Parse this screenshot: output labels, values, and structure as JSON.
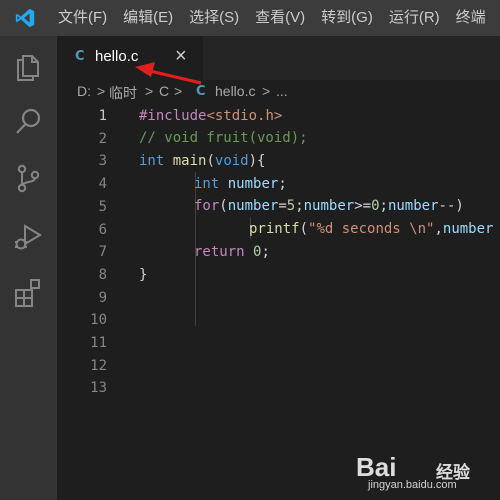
{
  "menu": [
    "文件(F)",
    "编辑(E)",
    "选择(S)",
    "查看(V)",
    "转到(G)",
    "运行(R)",
    "终端"
  ],
  "tab": {
    "title": "hello.c",
    "close": "×",
    "icon_letter": "C"
  },
  "breadcrumb": {
    "drive": "D:",
    "folder1": "临时",
    "folder2": "C",
    "file": "hello.c",
    "more": "...",
    "sep": ">"
  },
  "line_numbers": [
    "1",
    "2",
    "3",
    "4",
    "5",
    "6",
    "7",
    "8",
    "9",
    "10",
    "11",
    "12",
    "13"
  ],
  "code": {
    "l1": {
      "directive": "#include",
      "header": "<stdio.h>"
    },
    "l2": {
      "comment": "// void fruit(void);"
    },
    "l3": {
      "type": "int",
      "name": "main",
      "open": "(",
      "param": "void",
      "close": "){"
    },
    "l4": {
      "type": "int",
      "var": "number",
      "end": ";"
    },
    "l5": {
      "kw": "for",
      "p1": "(",
      "v1": "number",
      "eq": "=",
      "n1": "5",
      "s1": ";",
      "v2": "number",
      "ge": ">=",
      "n2": "0",
      "s2": ";",
      "v3": "number",
      "dec": "--)"
    },
    "l6": {
      "fn": "printf",
      "open": "(",
      "str": "\"%d seconds \\n\"",
      "comma": ",",
      "var": "number"
    },
    "l7": {
      "kw": "return",
      "num": "0",
      "end": ";"
    },
    "l8": {
      "brace": "}"
    }
  },
  "watermark": {
    "brand": "Bai",
    "brand_tail": "经验",
    "url": "jingyan.baidu.com"
  },
  "colors": {
    "accent": "#007acc",
    "annotation_arrow": "#e0201c"
  },
  "icons": [
    "explorer-icon",
    "search-icon",
    "source-control-icon",
    "run-debug-icon",
    "extensions-icon"
  ]
}
